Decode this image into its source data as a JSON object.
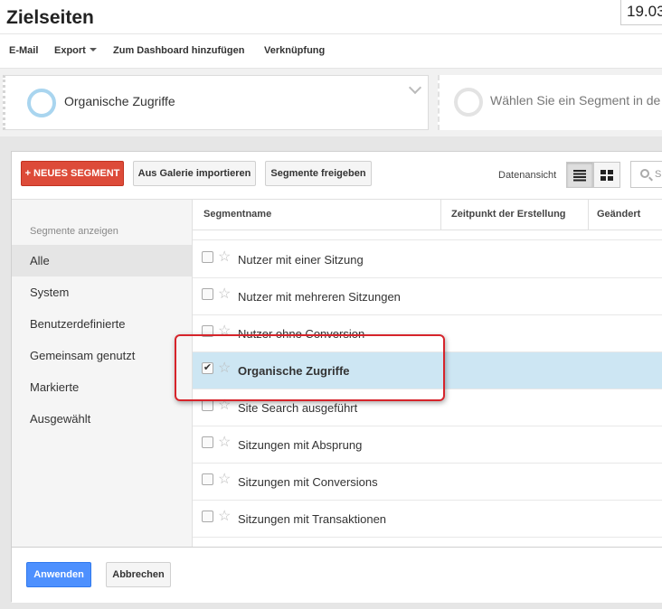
{
  "page": {
    "title": "Zielseiten",
    "date": "19.03"
  },
  "toolbar": {
    "email": "E-Mail",
    "export": "Export",
    "dashboard": "Zum Dashboard hinzufügen",
    "shortcut": "Verknüpfung"
  },
  "segments": {
    "active": "Organische Zugriffe",
    "placeholder": "Wählen Sie ein Segment in de"
  },
  "panel": {
    "new_segment": "+ NEUES SEGMENT",
    "import_gallery": "Aus Galerie importieren",
    "share_segments": "Segmente freigeben",
    "view_label": "Datenansicht",
    "search_placeholder": "S"
  },
  "sidebar": {
    "heading": "Segmente anzeigen",
    "items": [
      "Alle",
      "System",
      "Benutzerdefinierte",
      "Gemeinsam genutzt",
      "Markierte",
      "Ausgewählt"
    ],
    "active_index": 0
  },
  "table": {
    "headers": [
      "Segmentname",
      "Zeitpunkt der Erstellung",
      "Geändert"
    ],
    "rows": [
      {
        "name": "Nutzer mit einer Sitzung",
        "checked": false
      },
      {
        "name": "Nutzer mit mehreren Sitzungen",
        "checked": false
      },
      {
        "name": "Nutzer ohne Conversion",
        "checked": false
      },
      {
        "name": "Organische Zugriffe",
        "checked": true
      },
      {
        "name": "Site Search ausgeführt",
        "checked": false
      },
      {
        "name": "Sitzungen mit Absprung",
        "checked": false
      },
      {
        "name": "Sitzungen mit Conversions",
        "checked": false
      },
      {
        "name": "Sitzungen mit Transaktionen",
        "checked": false
      }
    ]
  },
  "footer": {
    "apply": "Anwenden",
    "cancel": "Abbrechen"
  },
  "colors": {
    "accent_red": "#dd4b39",
    "accent_blue": "#4d90fe",
    "selected_row": "#cde6f3",
    "highlight": "#d6242b"
  },
  "icons": {
    "star": "star-icon",
    "check": "checkmark-icon",
    "list_view": "list-view-icon",
    "grid_view": "grid-view-icon",
    "search": "search-icon"
  }
}
